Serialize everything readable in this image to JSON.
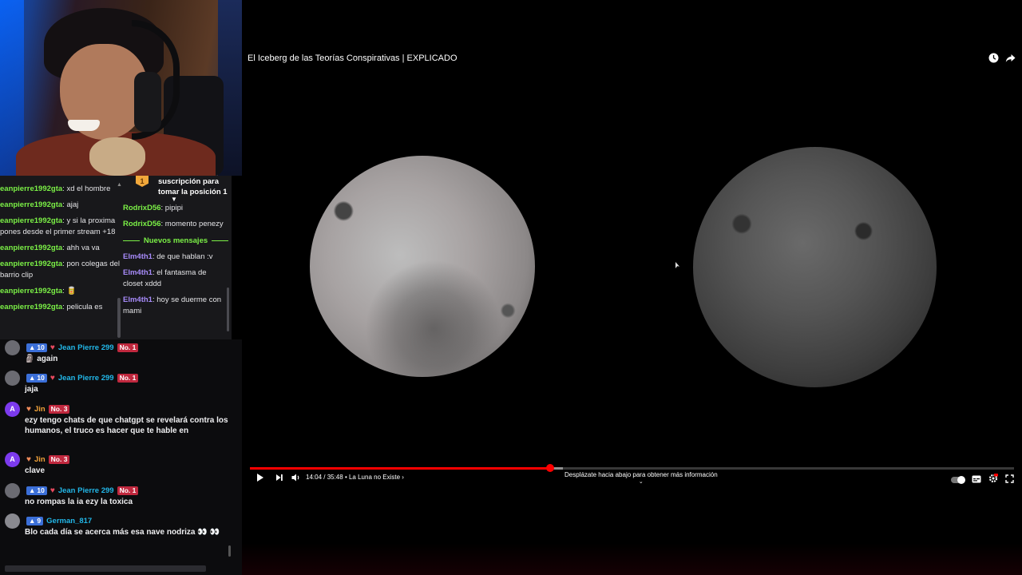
{
  "video": {
    "title": "El Iceberg de las Teorías Conspirativas | EXPLICADO",
    "time": "14:04 / 35:48",
    "chapter": "• La Luna no Existe ›",
    "scroll_hint": "Desplázate hacia abajo para obtener más información",
    "progress_fraction": 0.393,
    "buffered_fraction": 0.41,
    "accent_color": "#ff0000"
  },
  "twitch_chat": {
    "left": [
      {
        "user": "eanpierre1992gta",
        "text": "xd el hombre"
      },
      {
        "user": "eanpierre1992gta",
        "text": "ajaj"
      },
      {
        "user": "eanpierre1992gta",
        "text": "y si la proxima pones desde el primer stream +18"
      },
      {
        "user": "eanpierre1992gta",
        "text": "ahh va va"
      },
      {
        "user": "eanpierre1992gta",
        "text": "pon colegas del barrio clip"
      },
      {
        "user": "eanpierre1992gta",
        "text": "🥫"
      },
      {
        "user": "eanpierre1992gta",
        "text": "pelicula es"
      }
    ],
    "subscription": {
      "badge": "1",
      "text": "suscripción para tomar la posición 1"
    },
    "right_before": [
      {
        "user": "RodrixD56",
        "text": "pipipi"
      },
      {
        "user": "RodrixD56",
        "text": "momento penezy"
      }
    ],
    "new_messages_label": "Nuevos mensajes",
    "right_after": [
      {
        "user": "Elm4th1",
        "text": "de que hablan :v"
      },
      {
        "user": "Elm4th1",
        "text": "el fantasma de closet xddd"
      },
      {
        "user": "Elm4th1",
        "text": "hoy se duerme con mami"
      }
    ]
  },
  "kick_chat": {
    "messages": [
      {
        "avatar": "",
        "level": "10",
        "user": "Jean Pierre 299",
        "rank": "No. 1",
        "text": "🗿 again"
      },
      {
        "avatar": "",
        "level": "10",
        "user": "Jean Pierre 299",
        "rank": "No. 1",
        "text": "jaja"
      },
      {
        "avatar": "A",
        "level": "",
        "user": "Jin",
        "rank": "No. 3",
        "text": "ezy tengo chats de que chatgpt se revelará contra los humanos, el truco es hacer que te hable en"
      },
      {
        "avatar": "A",
        "level": "",
        "user": "Jin",
        "rank": "No. 3",
        "text": "clave"
      },
      {
        "avatar": "",
        "level": "10",
        "user": "Jean Pierre 299",
        "rank": "No. 1",
        "text": "no rompas la ia ezy la toxica"
      },
      {
        "avatar": "",
        "level": "9",
        "user": "German_817",
        "rank": "",
        "text": "Blo cada día se acerca más esa nave nodriza 👀 👀"
      }
    ]
  }
}
